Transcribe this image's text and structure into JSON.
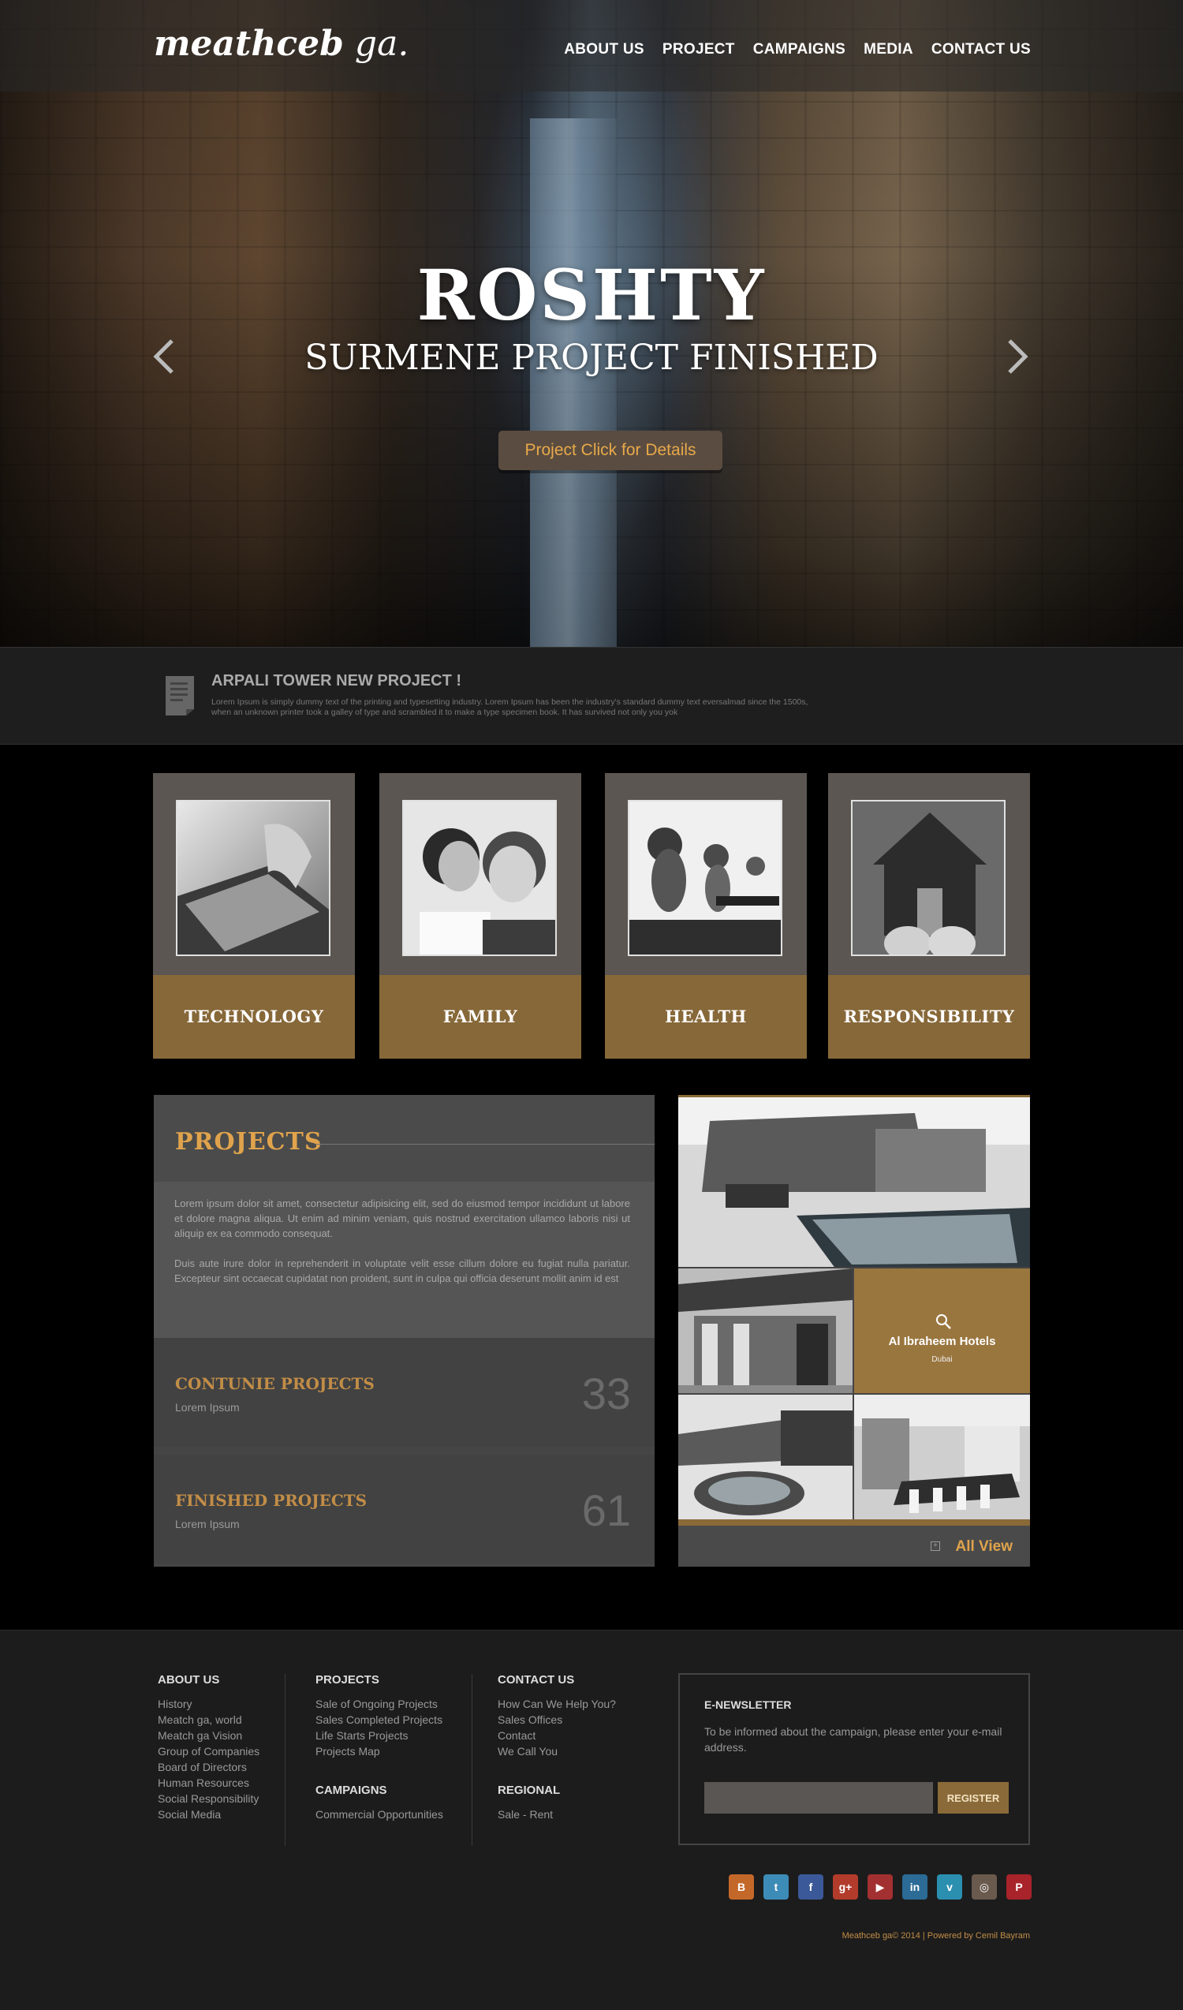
{
  "header": {
    "logo_main": "meathceb",
    "logo_thin": " ga.",
    "nav": [
      "ABOUT US",
      "PROJECT",
      "CAMPAIGNS",
      "MEDIA",
      "CONTACT US"
    ]
  },
  "hero": {
    "title": "ROSHTY",
    "subtitle": "SURMENE PROJECT FINISHED",
    "button": "Project Click for Details"
  },
  "news": {
    "title": "ARPALI TOWER NEW PROJECT !",
    "text": "Lorem Ipsum is simply dummy text of the printing and typesetting industry. Lorem Ipsum has been the industry's standard dummy text eversalmad since the 1500s, when an unknown printer took a galley of type and scrambled it to make a type specimen book. It has survived not only you yok"
  },
  "categories": [
    "TECHNOLOGY",
    "FAMILY",
    "HEALTH",
    "RESPONSIBILITY"
  ],
  "projects": {
    "title": "PROJECTS",
    "para1": "Lorem ipsum dolor sit amet, consectetur adipisicing elit, sed do eiusmod tempor incididunt ut labore et dolore magna aliqua. Ut enim ad minim veniam, quis nostrud exercitation ullamco laboris nisi ut aliquip ex ea commodo consequat.",
    "para2": "Duis aute irure dolor in reprehenderit in voluptate velit esse cillum dolore eu fugiat nulla pariatur. Excepteur sint occaecat cupidatat non proident, sunt in culpa qui officia deserunt mollit anim id est",
    "stats": [
      {
        "title": "CONTUNIE PROJECTS",
        "sub": "Lorem Ipsum",
        "number": "33"
      },
      {
        "title": "FINISHED PROJECTS",
        "sub": "Lorem Ipsum",
        "number": "61"
      }
    ]
  },
  "gallery": {
    "overlay_name": "Al Ibraheem Hotels",
    "overlay_city": "Dubai",
    "all_view": "All View"
  },
  "footer": {
    "about": {
      "title": "ABOUT US",
      "links": [
        "History",
        "Meatch ga, world",
        "Meatch ga Vision",
        "Group of Companies",
        "Board of Directors",
        "Human Resources",
        "Social Responsibility",
        "Social Media"
      ]
    },
    "projects": {
      "title": "PROJECTS",
      "links": [
        "Sale of Ongoing Projects",
        "Sales Completed Projects",
        "Life Starts Projects",
        "Projects Map"
      ]
    },
    "campaigns": {
      "title": "CAMPAIGNS",
      "links": [
        "Commercial Opportunities"
      ]
    },
    "contact": {
      "title": "CONTACT US",
      "links": [
        "How Can We Help You?",
        "Sales Offices",
        "Contact",
        "We Call You"
      ]
    },
    "regional": {
      "title": "REGIONAL",
      "links": [
        "Sale - Rent"
      ]
    },
    "newsletter": {
      "title": "E-NEWSLETTER",
      "text": "To be informed about the campaign, please enter your e-mail address.",
      "button": "REGISTER"
    },
    "socials": [
      {
        "icon": "blogger-icon",
        "glyph": "B",
        "color": "#c4682a"
      },
      {
        "icon": "twitter-icon",
        "glyph": "t",
        "color": "#3d8bb7"
      },
      {
        "icon": "facebook-icon",
        "glyph": "f",
        "color": "#3b5998"
      },
      {
        "icon": "google-plus-icon",
        "glyph": "g+",
        "color": "#b23b2b"
      },
      {
        "icon": "youtube-icon",
        "glyph": "▶",
        "color": "#a33030"
      },
      {
        "icon": "linkedin-icon",
        "glyph": "in",
        "color": "#2b6b96"
      },
      {
        "icon": "vimeo-icon",
        "glyph": "v",
        "color": "#2b8fb0"
      },
      {
        "icon": "instagram-icon",
        "glyph": "◎",
        "color": "#6a5a4e"
      },
      {
        "icon": "pinterest-icon",
        "glyph": "P",
        "color": "#a8232a"
      }
    ],
    "copyright": "Meathceb ga© 2014 | Powered by Cemil Bayram"
  }
}
